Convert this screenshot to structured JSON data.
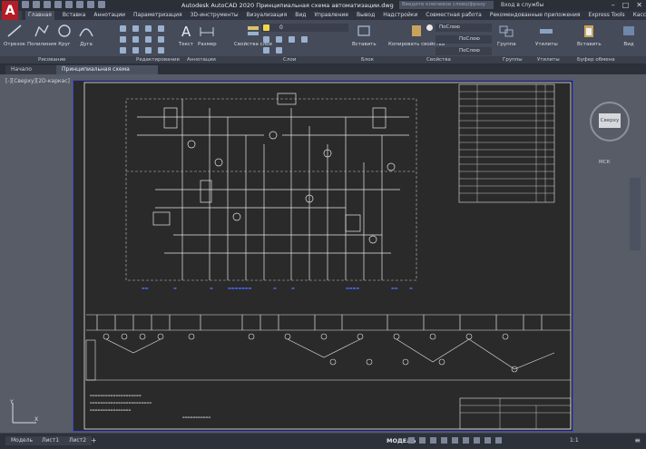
{
  "app": {
    "logo": "A",
    "title": "Autodesk AutoCAD 2020   Принципиальная схема автоматизации.dwg",
    "search_placeholder": "Введите ключевое слово/фразу",
    "user": "Вход в службы"
  },
  "menu": [
    "Главная",
    "Вставка",
    "Аннотации",
    "Параметризация",
    "3D-инструменты",
    "Визуализация",
    "Вид",
    "Управление",
    "Вывод",
    "Надстройки",
    "Совместная работа",
    "Рекомендованные приложения",
    "Express Tools",
    "Касса Tools"
  ],
  "ribbon": {
    "tools": [
      {
        "label": "Отрезок"
      },
      {
        "label": "Полилиния"
      },
      {
        "label": "Круг"
      },
      {
        "label": "Дуга"
      },
      {
        "label": "Текст"
      },
      {
        "label": "Размер"
      },
      {
        "label": "Свойства слоя"
      },
      {
        "label": "Вставить"
      },
      {
        "label": "Копировать свойства"
      },
      {
        "label": "Группа"
      },
      {
        "label": "Утилиты"
      },
      {
        "label": "Вставить"
      },
      {
        "label": "Вид"
      }
    ],
    "layer_value": "0",
    "bylayer1": "ПоСлою",
    "bylayer2": "ПоСлою",
    "bylayer3": "ПоСлою",
    "panels": [
      "Рисование",
      "Редактирование",
      "Аннотации",
      "Слои",
      "Блок",
      "Свойства",
      "Группы",
      "Утилиты",
      "Буфер обмена"
    ]
  },
  "doctabs": [
    "Начало",
    "Принципиальная схема автомат..."
  ],
  "viewport_label": "[-][Сверху][2D-каркас]",
  "navcube": {
    "face": "Сверху",
    "wcs": "МСК"
  },
  "ucs": {
    "y": "Y",
    "x": "X"
  },
  "status": {
    "tabs": [
      "Модель",
      "Лист1",
      "Лист2"
    ],
    "model": "МОДЕЛЬ",
    "scale": "1:1"
  }
}
